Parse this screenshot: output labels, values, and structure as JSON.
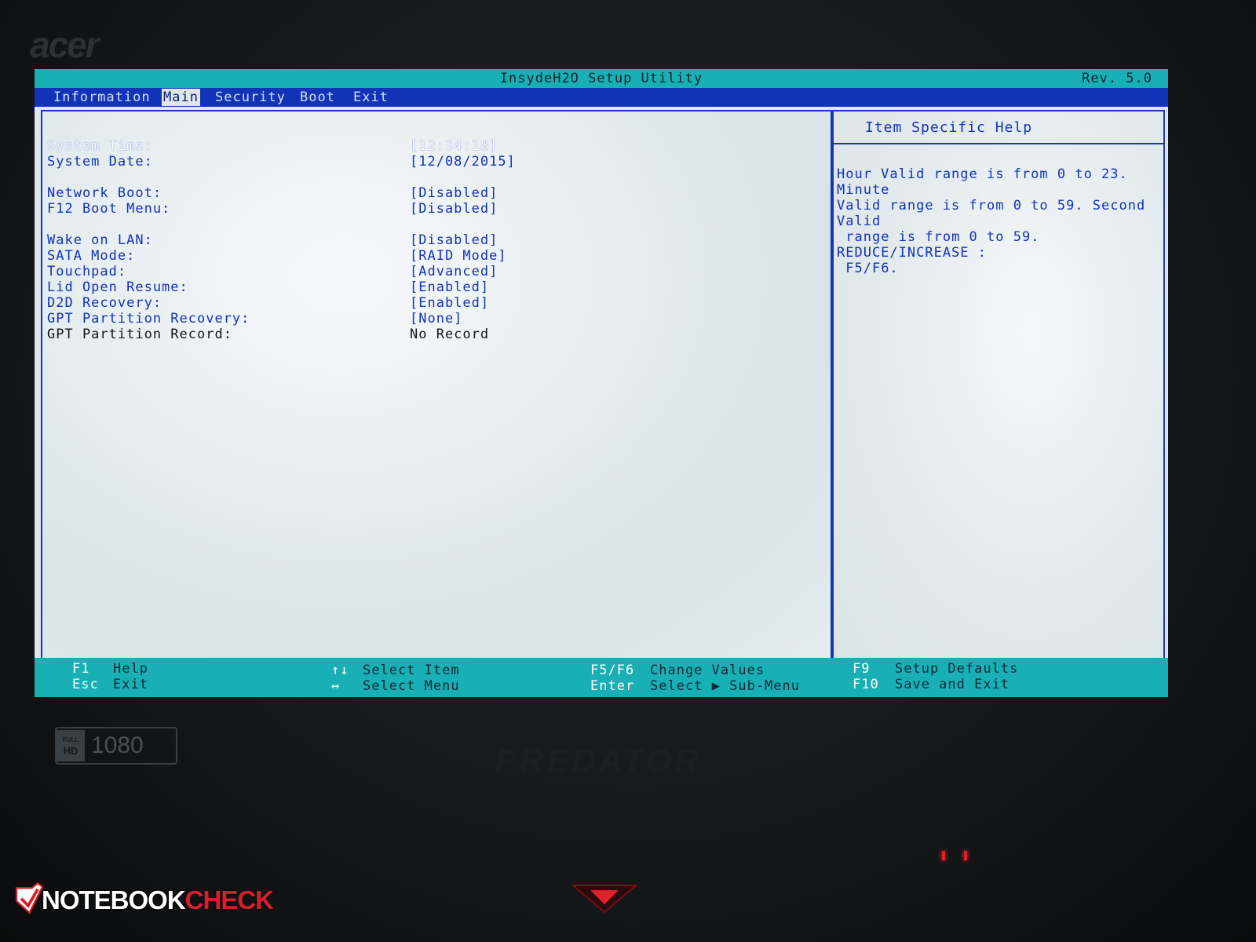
{
  "bezel": {
    "brand": "acer",
    "hd_badge_top": "FULL",
    "hd_badge_bottom": "HD",
    "hd_badge_number": "1080",
    "model": "PREDATOR"
  },
  "watermark": {
    "part1": "NOTEBOOK",
    "part2": "CHECK"
  },
  "bios": {
    "title": "InsydeH2O Setup Utility",
    "revision": "Rev. 5.0",
    "tabs": [
      {
        "label": "Information"
      },
      {
        "label": "Main"
      },
      {
        "label": "Security"
      },
      {
        "label": "Boot"
      },
      {
        "label": "Exit"
      }
    ],
    "active_tab": "Main",
    "settings": [
      {
        "label": "System Time:",
        "value": "[12:34:18]"
      },
      {
        "label": "System Date:",
        "value": "[12/08/2015]"
      },
      {
        "label": "Network Boot:",
        "value": "[Disabled]"
      },
      {
        "label": "F12 Boot Menu:",
        "value": "[Disabled]"
      },
      {
        "label": "Wake on LAN:",
        "value": "[Disabled]"
      },
      {
        "label": "SATA Mode:",
        "value": "[RAID Mode]"
      },
      {
        "label": "Touchpad:",
        "value": "[Advanced]"
      },
      {
        "label": "Lid Open Resume:",
        "value": "[Enabled]"
      },
      {
        "label": "D2D Recovery:",
        "value": "[Enabled]"
      },
      {
        "label": "GPT Partition Recovery:",
        "value": "[None]"
      },
      {
        "label": "GPT Partition Record:",
        "value": "No Record"
      }
    ],
    "help": {
      "title": "Item Specific Help",
      "text": "Hour Valid range is from 0 to 23. Minute\nValid range is from 0 to 59. Second Valid\n range is from 0 to 59. REDUCE/INCREASE :\n F5/F6."
    },
    "footer": {
      "f1_key": "F1",
      "f1_desc": "Help",
      "esc_key": "Esc",
      "esc_desc": "Exit",
      "updown_key": "↑↓",
      "updown_desc": "Select Item",
      "leftright_key": "↔",
      "leftright_desc": "Select Menu",
      "f5f6_key": "F5/F6",
      "f5f6_desc": "Change Values",
      "enter_key": "Enter",
      "enter_desc": "Select ▶ Sub-Menu",
      "f9_key": "F9",
      "f9_desc": "Setup Defaults",
      "f10_key": "F10",
      "f10_desc": "Save and Exit"
    },
    "colors": {
      "title_bar": "#18b0b4",
      "menu_bar": "#1232b8",
      "text": "#1232b8",
      "panel_bg": "#e8eff2"
    }
  }
}
